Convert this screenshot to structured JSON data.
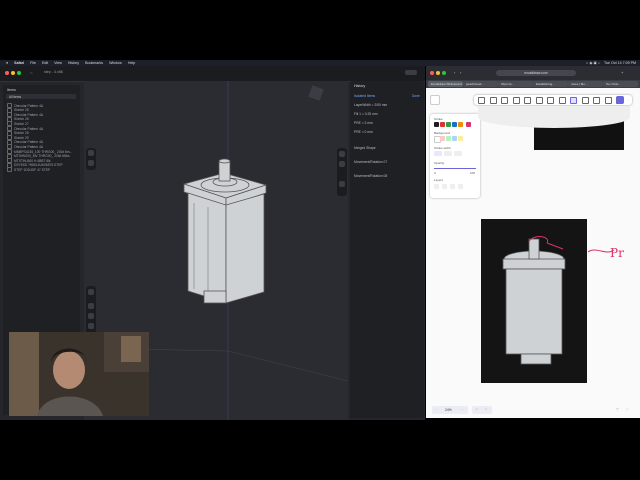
{
  "menubar": {
    "apple": "",
    "items": [
      "Safari",
      "File",
      "Edit",
      "View",
      "History",
      "Bookmarks",
      "Window",
      "Help"
    ],
    "clock": "Tue Oct 14  7:09 PM"
  },
  "cad": {
    "window_title": "step - 4.x86",
    "sidebar_header": "Items",
    "sidebar_filter": "All items",
    "tree": [
      "Obrcular Pattern 4A",
      "Sketch 25",
      "Obrcular Pattern 4A",
      "Sketch 26",
      "Sketch 27",
      "Obrcular Pattern 4A",
      "Sketch 28",
      "Sketch 29",
      "Obrcular Pattern 4A",
      "Obrcular Pattern 4A",
      "MM8PS4235_100 THRG00_ 2Gkt 6m...",
      "MT3HN200_MV THRG00_ 2Gkt 6Nks",
      "MTSTHLB00 H 4BBT 6lk",
      "DSY5SS ?H80L4UK06575.STEP",
      "STEP 1DD4SF 47 STEP"
    ],
    "history_header": "History",
    "history_sub": "Isolated Items",
    "history_done": "Done",
    "history_rows": [
      "LayerWidth = 2/50 mm",
      "Fill 1 = 0.25 mm",
      "PRE = 3 mm",
      "PRE = 0 mm",
      "Merged Shape",
      "Movement/Rotation 07",
      "Movement/Rotation 08"
    ]
  },
  "browser": {
    "address": "excalidraw.com",
    "tabs": [
      "Excalidraw Whiteboard",
      "peachcloud...",
      "https://p...",
      "Establishing...",
      "notes | Mo...",
      "Tex Chal..."
    ],
    "props": {
      "stroke_label": "Stroke",
      "background_label": "Background",
      "stroke_width_label": "Stroke width",
      "opacity_label": "Opacity",
      "opacity_min": "0",
      "opacity_max": "100",
      "layers_label": "Layers"
    },
    "zoom": "24%",
    "handwriting": "Pr"
  },
  "colors": {
    "menubar_bg": "#1d1f2b",
    "cad_bg": "#24262b",
    "accent": "#3b6ef5",
    "excalidraw_accent": "#6965db",
    "annotation_red": "#d6336c"
  }
}
